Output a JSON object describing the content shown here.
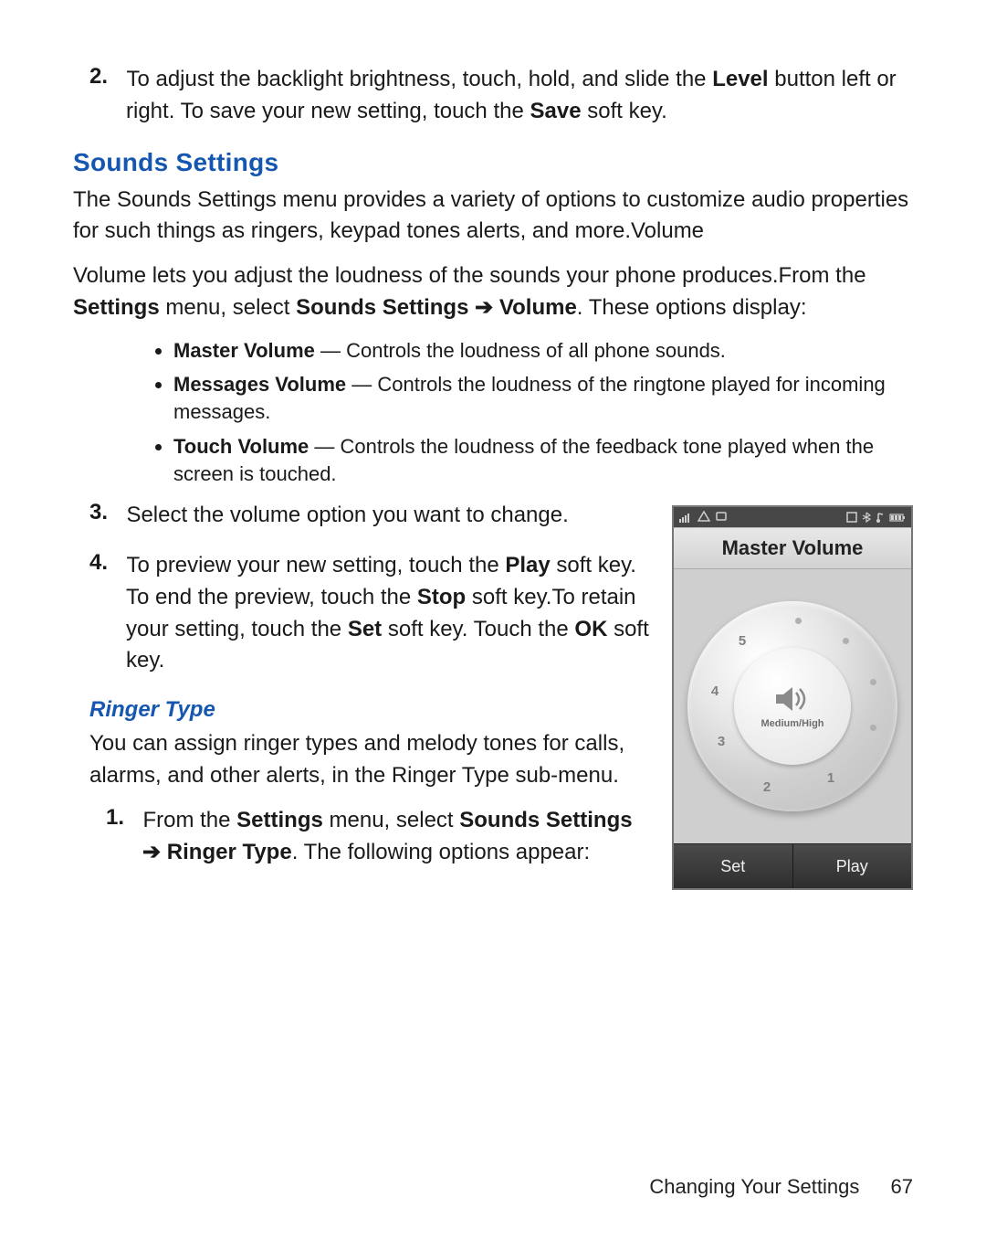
{
  "step2": {
    "num": "2.",
    "pre": "To adjust the backlight brightness, touch, hold, and slide the ",
    "bold1": "Level",
    "mid1": " button left or right. To save your new setting, touch the ",
    "bold2": "Save",
    "post": " soft key."
  },
  "sounds": {
    "heading": "Sounds Settings",
    "intro": "The Sounds Settings menu provides a variety of options to customize audio properties for such things as ringers, keypad tones alerts, and more.Volume",
    "volume_pre": "Volume lets you adjust the loudness of the sounds your phone produces.From the ",
    "volume_b1": "Settings",
    "volume_mid1": " menu, select ",
    "volume_b2": "Sounds Settings",
    "volume_arrow": " ➔ ",
    "volume_b3": "Volume",
    "volume_post": ". These options display:",
    "bullets": [
      {
        "label": "Master Volume",
        "desc": " — Controls the loudness of all phone sounds."
      },
      {
        "label": "Messages Volume",
        "desc": " — Controls the loudness of the ringtone played for incoming messages."
      },
      {
        "label": "Touch Volume",
        "desc": " — Controls the loudness of the feedback tone played when the screen is touched."
      }
    ]
  },
  "step3": {
    "num": "3.",
    "text": "Select the volume option you want to change."
  },
  "step4": {
    "num": "4.",
    "pre": "To preview your new setting, touch the ",
    "b1": "Play",
    "mid1": " soft key. To end the preview, touch the ",
    "b2": "Stop",
    "mid2": " soft key.To retain your setting, touch the ",
    "b3": "Set",
    "mid3": " soft key. Touch the ",
    "b4": "OK",
    "post": " soft key."
  },
  "ringer": {
    "heading": "Ringer Type",
    "intro": "You can assign ringer types and melody tones for calls, alarms, and other alerts, in the Ringer Type sub-menu.",
    "step1": {
      "num": "1.",
      "pre": "From the ",
      "b1": "Settings",
      "mid1": " menu, select ",
      "b2": "Sounds Settings",
      "arrow": "➔ ",
      "b3": "Ringer Type",
      "post": ". The following options appear:"
    }
  },
  "phone": {
    "title": "Master Volume",
    "level_label": "Medium/High",
    "numbers": [
      "1",
      "2",
      "3",
      "4",
      "5"
    ],
    "softkeys": {
      "left": "Set",
      "right": "Play"
    }
  },
  "footer": {
    "section": "Changing Your Settings",
    "page": "67"
  }
}
